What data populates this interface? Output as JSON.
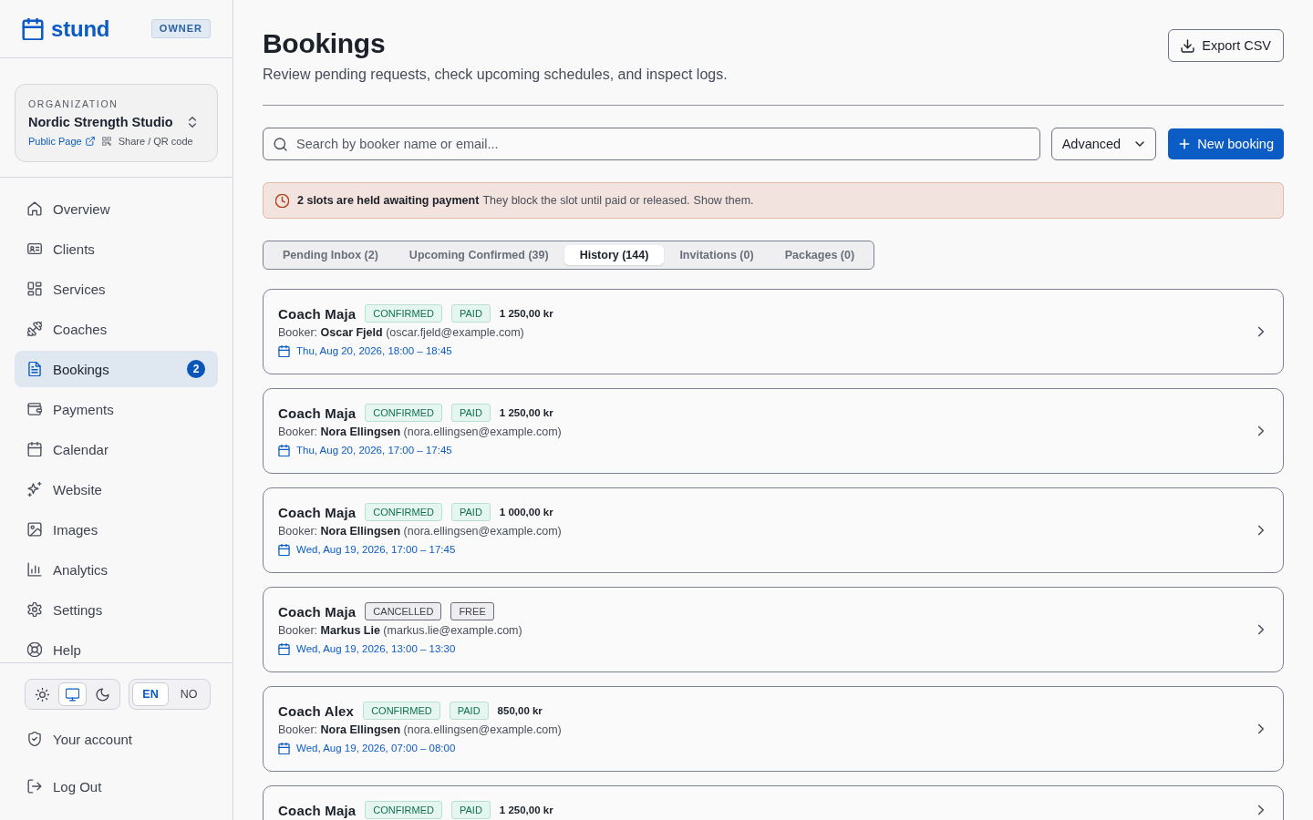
{
  "sidebar": {
    "brand": "stund",
    "role_badge": "OWNER",
    "organization": {
      "label": "ORGANIZATION",
      "name": "Nordic Strength Studio",
      "public_page_link": "Public Page",
      "share_link": "Share / QR code"
    },
    "nav_items": [
      {
        "label": "Overview",
        "selected": false
      },
      {
        "label": "Clients",
        "selected": false
      },
      {
        "label": "Services",
        "selected": false
      },
      {
        "label": "Coaches",
        "selected": false
      },
      {
        "label": "Bookings",
        "selected": true,
        "badge": "2"
      },
      {
        "label": "Payments",
        "selected": false
      },
      {
        "label": "Calendar",
        "selected": false
      },
      {
        "label": "Website",
        "selected": false
      },
      {
        "label": "Images",
        "selected": false
      },
      {
        "label": "Analytics",
        "selected": false
      },
      {
        "label": "Settings",
        "selected": false
      },
      {
        "label": "Help",
        "selected": false
      }
    ],
    "theme_options": [
      {
        "kind": "light",
        "selected": false
      },
      {
        "kind": "system",
        "selected": true
      },
      {
        "kind": "dark",
        "selected": false
      }
    ],
    "language_options": [
      {
        "label": "EN",
        "selected": true
      },
      {
        "label": "NO",
        "selected": false
      }
    ],
    "account_links": [
      {
        "label": "Your account"
      },
      {
        "label": "Log Out"
      }
    ]
  },
  "header": {
    "title": "Bookings",
    "subtitle": "Review pending requests, check upcoming schedules, and inspect logs.",
    "export_button": "Export CSV"
  },
  "toolbar": {
    "search": {
      "placeholder": "Search by booker name or email..."
    },
    "advanced_button": "Advanced",
    "new_button": "New booking"
  },
  "alert": {
    "title": "2 slots are held awaiting payment",
    "message": "They block the slot until paid or released.",
    "link": "Show them."
  },
  "tabs": [
    {
      "label": "Pending Inbox (2)",
      "selected": false
    },
    {
      "label": "Upcoming Confirmed (39)",
      "selected": false
    },
    {
      "label": "History (144)",
      "selected": true
    },
    {
      "label": "Invitations (0)",
      "selected": false
    },
    {
      "label": "Packages (0)",
      "selected": false
    }
  ],
  "bookings": [
    {
      "coach": "Coach Maja",
      "status": {
        "label": "CONFIRMED",
        "kind": "confirmed"
      },
      "payment": {
        "label": "PAID",
        "kind": "paid"
      },
      "price": "1 250,00 kr",
      "booker": "Booker: **Oscar Fjeld** (oscar.fjeld@example.com)",
      "time": "Thu, Aug 20, 2026, 18:00 – 18:45"
    },
    {
      "coach": "Coach Maja",
      "status": {
        "label": "CONFIRMED",
        "kind": "confirmed"
      },
      "payment": {
        "label": "PAID",
        "kind": "paid"
      },
      "price": "1 250,00 kr",
      "booker": "Booker: **Nora Ellingsen** (nora.ellingsen@example.com)",
      "time": "Thu, Aug 20, 2026, 17:00 – 17:45"
    },
    {
      "coach": "Coach Maja",
      "status": {
        "label": "CONFIRMED",
        "kind": "confirmed"
      },
      "payment": {
        "label": "PAID",
        "kind": "paid"
      },
      "price": "1 000,00 kr",
      "booker": "Booker: **Nora Ellingsen** (nora.ellingsen@example.com)",
      "time": "Wed, Aug 19, 2026, 17:00 – 17:45"
    },
    {
      "coach": "Coach Maja",
      "status": {
        "label": "CANCELLED",
        "kind": "cancelled"
      },
      "payment": {
        "label": "FREE",
        "kind": "free"
      },
      "booker": "Booker: **Markus Lie** (markus.lie@example.com)",
      "time": "Wed, Aug 19, 2026, 13:00 – 13:30"
    },
    {
      "coach": "Coach Alex",
      "status": {
        "label": "CONFIRMED",
        "kind": "confirmed"
      },
      "payment": {
        "label": "PAID",
        "kind": "paid"
      },
      "price": "850,00 kr",
      "booker": "Booker: **Nora Ellingsen** (nora.ellingsen@example.com)",
      "time": "Wed, Aug 19, 2026, 07:00 – 08:00"
    },
    {
      "coach": "Coach Maja",
      "status": {
        "label": "CONFIRMED",
        "kind": "confirmed"
      },
      "payment": {
        "label": "PAID",
        "kind": "paid"
      },
      "price": "1 250,00 kr"
    }
  ]
}
